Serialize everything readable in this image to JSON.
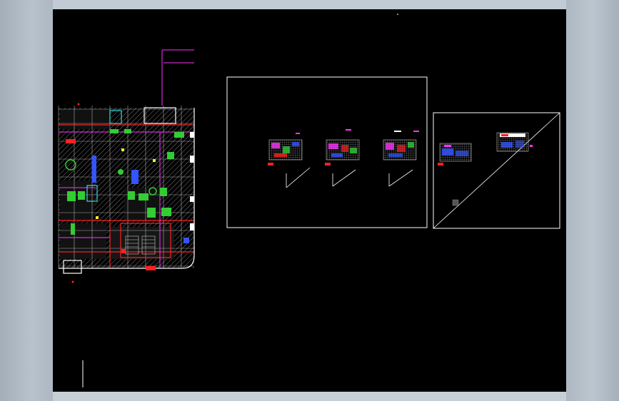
{
  "window": {
    "background": "#000000",
    "chrome_color": "#b4bec8"
  },
  "drawing": {
    "layers": {
      "grid": "#d8d8d8",
      "hatch": "#9a9a9a",
      "walls": "#ffffff",
      "magenta": "#ff33ff",
      "red": "#ff2020",
      "green": "#33dd33",
      "blue": "#3355ff",
      "cyan": "#33dddd",
      "yellow": "#ffee33"
    },
    "sheets": [
      "sheet-1",
      "sheet-2",
      "sheet-3",
      "sheet-4",
      "sheet-5"
    ]
  }
}
